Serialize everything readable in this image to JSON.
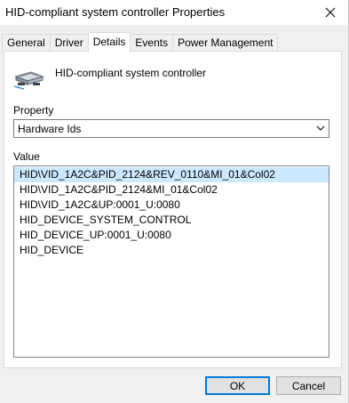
{
  "window": {
    "title": "HID-compliant system controller Properties"
  },
  "tabs": [
    {
      "label": "General",
      "active": false
    },
    {
      "label": "Driver",
      "active": false
    },
    {
      "label": "Details",
      "active": true
    },
    {
      "label": "Events",
      "active": false
    },
    {
      "label": "Power Management",
      "active": false
    }
  ],
  "details": {
    "device_name": "HID-compliant system controller",
    "device_icon": "hid-device-icon",
    "property_label": "Property",
    "property_selected": "Hardware Ids",
    "value_label": "Value",
    "values": [
      "HID\\VID_1A2C&PID_2124&REV_0110&MI_01&Col02",
      "HID\\VID_1A2C&PID_2124&MI_01&Col02",
      "HID\\VID_1A2C&UP:0001_U:0080",
      "HID_DEVICE_SYSTEM_CONTROL",
      "HID_DEVICE_UP:0001_U:0080",
      "HID_DEVICE"
    ],
    "selected_index": 0
  },
  "buttons": {
    "ok": "OK",
    "cancel": "Cancel"
  },
  "colors": {
    "accent": "#0078d7",
    "selection": "#cce8ff"
  }
}
